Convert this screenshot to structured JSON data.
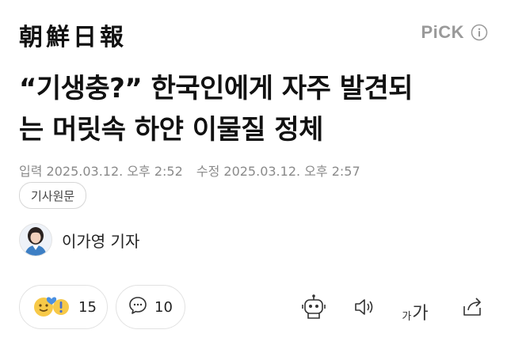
{
  "header": {
    "logo": "朝鮮日報",
    "pick_label": "PiCK",
    "pick_icon": "info-icon"
  },
  "article": {
    "title_line1": "“기생충?” 한국인에게 자주 발견되",
    "title_line2": "는 머릿속 하얀 이물질 정체",
    "published": "입력 2025.03.12. 오후 2:52",
    "modified": "수정 2025.03.12. 오후 2:57",
    "original_button": "기사원문"
  },
  "reporter": {
    "name": "이가영 기자",
    "avatar_icon": "reporter-avatar"
  },
  "actions": {
    "reactions_count": "15",
    "comments_count": "10",
    "font_small": "가",
    "font_big": "가"
  },
  "colors": {
    "muted_text": "#8a8a8a",
    "pick_gray": "#9a9a9a",
    "emoji_yellow": "#f7c948",
    "heart_blue": "#4a90e2"
  }
}
